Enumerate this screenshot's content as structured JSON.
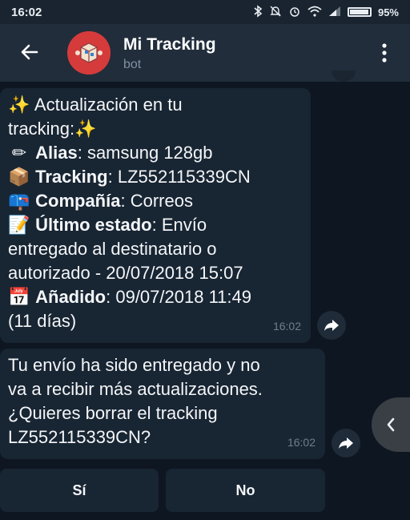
{
  "status_bar": {
    "time": "16:02",
    "battery_percent": "95%",
    "battery_level": 0.95
  },
  "header": {
    "title": "Mi Tracking",
    "subtitle": "bot"
  },
  "messages": [
    {
      "lines": [
        {
          "emoji": "✨",
          "bold": "",
          "text": "Actualización en tu"
        },
        {
          "emoji": "",
          "bold": "",
          "text": "tracking:",
          "trail_emoji": "✨"
        },
        {
          "emoji": "✏",
          "bold": "Alias",
          "text": ": samsung 128gb"
        },
        {
          "emoji": "📦",
          "bold": "Tracking",
          "text": ": LZ552115339CN"
        },
        {
          "emoji": "📪",
          "bold": "Compañía",
          "text": ": Correos"
        },
        {
          "emoji": "📝",
          "bold": "Último estado",
          "text": ": Envío"
        },
        {
          "emoji": "",
          "bold": "",
          "text": "entregado al destinatario o"
        },
        {
          "emoji": "",
          "bold": "",
          "text": "autorizado - 20/07/2018 15:07"
        },
        {
          "emoji": "📅",
          "bold": "Añadido",
          "text": ": 09/07/2018 11:49"
        },
        {
          "emoji": "",
          "bold": "",
          "text": "(11 días)"
        }
      ],
      "time": "16:02"
    },
    {
      "lines": [
        {
          "text": "Tu envío ha sido entregado y no"
        },
        {
          "text": "va a recibir más actualizaciones."
        },
        {
          "text": "¿Quieres borrar el tracking"
        },
        {
          "text": "LZ552115339CN?"
        }
      ],
      "time": "16:02"
    }
  ],
  "keyboard": {
    "yes_label": "Sí",
    "no_label": "No"
  }
}
